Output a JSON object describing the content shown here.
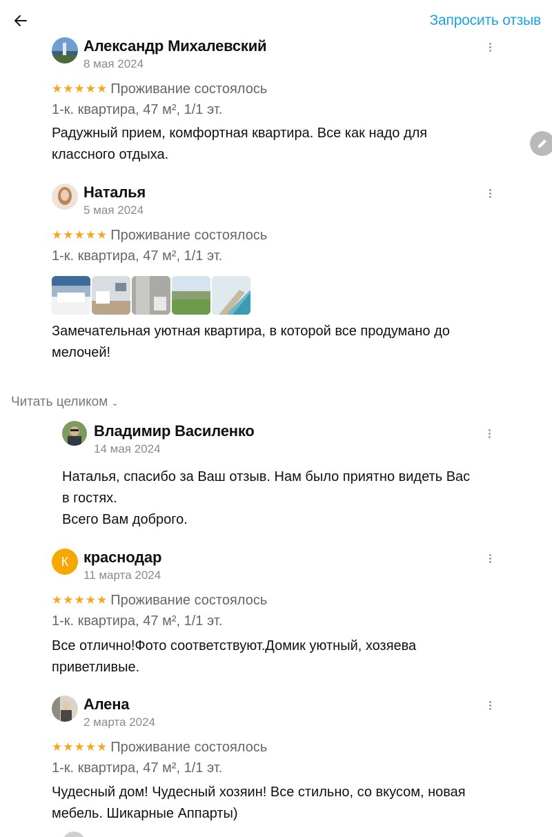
{
  "header": {
    "back_icon": "arrow-left-icon",
    "request_review_label": "Запросить отзыв",
    "accent_color": "#1ea1e0"
  },
  "reviews": [
    {
      "author": "Александр Михалевский",
      "date": "8 мая 2024",
      "stars": "★★★★★",
      "status": "Проживание состоялось",
      "room": "1-к. квартира, 47 м², 1/1 эт.",
      "text_lines": [
        "Радужный прием, комфортная квартира. Все как надо для",
        "классного отдыха."
      ]
    },
    {
      "author": "Наталья",
      "date": "5 мая 2024",
      "stars": "★★★★★",
      "status": "Проживание состоялось",
      "room": "1-к. квартира, 47 м², 1/1 эт.",
      "text_lines": [
        "Замечательная уютная квартира, в которой все продумано до",
        "мелочей!"
      ]
    },
    {
      "author": "краснодар",
      "avatar_letter": "К",
      "date": "11 марта 2024",
      "stars": "★★★★★",
      "status": "Проживание состоялось",
      "room": "1-к. квартира, 47 м², 1/1 эт.",
      "text_lines": [
        "Все отлично!Фото соответствуют.Домик уютный, хозяева",
        "приветливые."
      ]
    },
    {
      "author": "Алена",
      "date": "2 марта 2024",
      "stars": "★★★★★",
      "status": "Проживание состоялось",
      "room": "1-к. квартира, 47 м², 1/1 эт.",
      "text_lines": [
        "Чудесный дом! Чудесный хозяин! Все стильно, со вкусом, новая",
        "мебель. Шикарные Аппарты)"
      ]
    }
  ],
  "read_full_label": "Читать целиком",
  "reply": {
    "author": "Владимир Василенко",
    "date": "14 мая 2024",
    "text_lines": [
      "Наталья, спасибо за Ваш отзыв. Нам было приятно видеть  Вас",
      "в гостях.",
      "Всего Вам доброго."
    ]
  },
  "colors": {
    "star": "#f5a623",
    "muted_text": "#666666",
    "avatar_orange": "#f6a800"
  }
}
